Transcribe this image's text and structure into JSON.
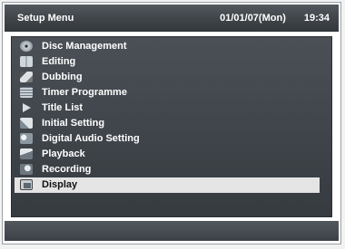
{
  "header": {
    "title": "Setup Menu",
    "date": "01/01/07(Mon)",
    "time": "19:34"
  },
  "menu": {
    "items": [
      {
        "label": "Disc Management",
        "icon": "disc-icon"
      },
      {
        "label": "Editing",
        "icon": "editing-icon"
      },
      {
        "label": "Dubbing",
        "icon": "dubbing-icon"
      },
      {
        "label": "Timer Programme",
        "icon": "timer-icon"
      },
      {
        "label": "Title List",
        "icon": "play-icon"
      },
      {
        "label": "Initial Setting",
        "icon": "initial-setting-icon"
      },
      {
        "label": "Digital Audio Setting",
        "icon": "audio-icon"
      },
      {
        "label": "Playback",
        "icon": "playback-icon"
      },
      {
        "label": "Recording",
        "icon": "recording-icon"
      },
      {
        "label": "Display",
        "icon": "display-icon"
      }
    ],
    "selected": "Display"
  },
  "colors": {
    "header_bg": "#3f4449",
    "panel_bg": "#404549",
    "selected_bg": "#e4e4e4",
    "text": "#ffffff"
  }
}
